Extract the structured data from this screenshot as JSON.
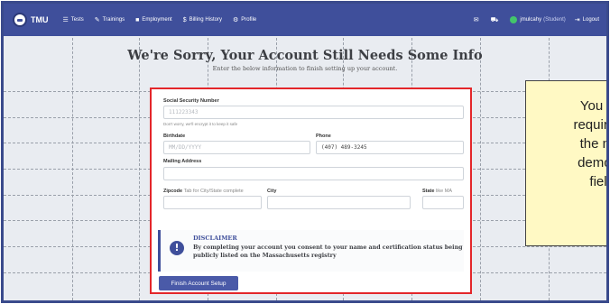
{
  "navbar": {
    "brand": "TMU",
    "items": [
      {
        "label": "Tests",
        "icon": "list-icon"
      },
      {
        "label": "Trainings",
        "icon": "pencil-icon"
      },
      {
        "label": "Employment",
        "icon": "briefcase-icon"
      },
      {
        "label": "Billing History",
        "icon": "dollar-icon"
      },
      {
        "label": "Profile",
        "icon": "gear-icon"
      }
    ],
    "user": "jmulcahy",
    "user_role": "(Student)",
    "logout": "Logout"
  },
  "header": {
    "title": "We're Sorry, Your Account Still Needs Some Info",
    "subtitle": "Enter the below information to finish setting up your account."
  },
  "form": {
    "ssn": {
      "label": "Social Security Number",
      "placeholder": "111223343",
      "help": "Don't worry, we'll encrypt it to keep it safe"
    },
    "birthdate": {
      "label": "Birthdate",
      "placeholder": "MM/DD/YYYY"
    },
    "phone": {
      "label": "Phone",
      "value": "(407) 489-3245"
    },
    "mailing_address": {
      "label": "Mailing Address",
      "value": ""
    },
    "zipcode": {
      "label": "Zipcode",
      "hint": "Tab for City/State complete",
      "value": ""
    },
    "city": {
      "label": "City",
      "value": ""
    },
    "state": {
      "label": "State",
      "hint": "like MA",
      "value": ""
    },
    "disclaimer": {
      "title": "DISCLAIMER",
      "text": "By completing your account you consent to your name and certification status being publicly listed on the Massachusetts registry"
    },
    "submit_label": "Finish Account Setup"
  },
  "callout": {
    "text": "You w\nrequired\nthe mi\ndemog\nfiel"
  },
  "colors": {
    "navbar": "#3f4f9b",
    "highlight_border": "#e3262a",
    "callout_bg": "#fff9c4"
  }
}
